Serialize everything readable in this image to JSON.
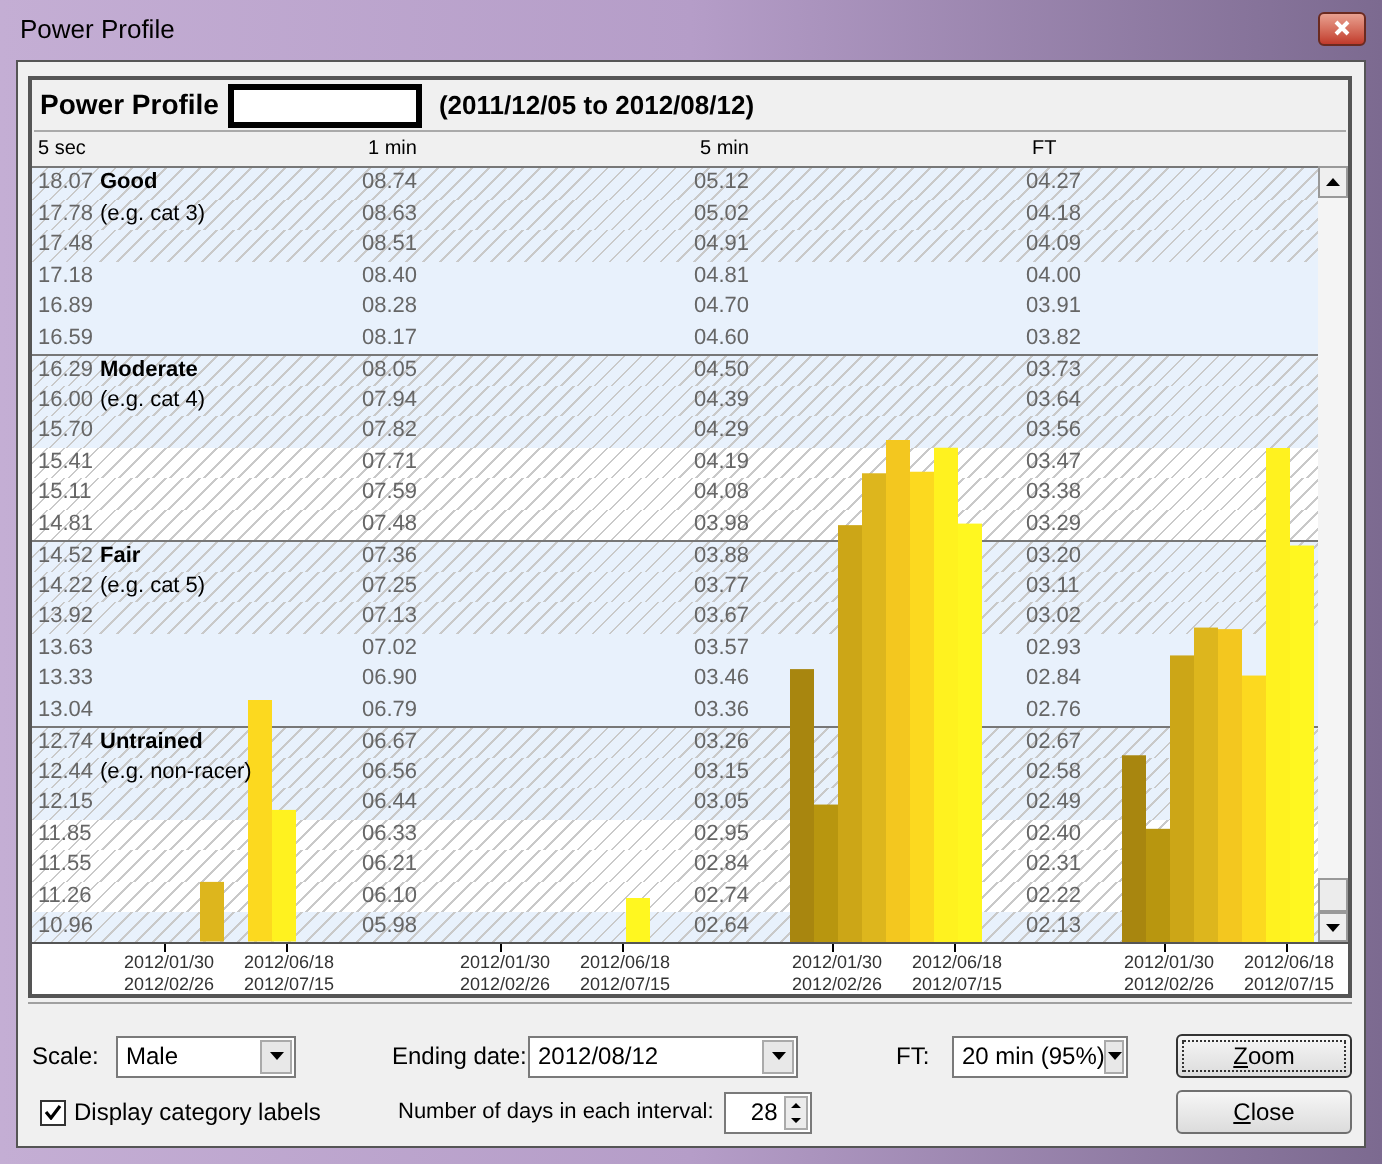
{
  "window": {
    "title": "Power Profile"
  },
  "header": {
    "title": "Power Profile",
    "date_range": "(2011/12/05 to 2012/08/12)"
  },
  "columns": [
    {
      "label": "5 sec",
      "axis_labels": [
        "2012/01/30",
        "2012/02/26",
        "2012/06/18",
        "2012/07/15"
      ]
    },
    {
      "label": "1 min",
      "axis_labels": [
        "2012/01/30",
        "2012/02/26",
        "2012/06/18",
        "2012/07/15"
      ]
    },
    {
      "label": "5 min",
      "axis_labels": [
        "2012/01/30",
        "2012/02/26",
        "2012/06/18",
        "2012/07/15"
      ]
    },
    {
      "label": "FT",
      "axis_labels": [
        "2012/01/30",
        "2012/02/26",
        "2012/06/18",
        "2012/07/15"
      ]
    }
  ],
  "categories": [
    {
      "name": "Good",
      "example": "(e.g. cat 3)",
      "rows": [
        {
          "kind": "hatched_blue",
          "values": [
            "18.07",
            "08.74",
            "05.12",
            "04.27"
          ]
        },
        {
          "kind": "hatched_blue",
          "values": [
            "17.78",
            "08.63",
            "05.02",
            "04.18"
          ]
        },
        {
          "kind": "hatched_blue",
          "values": [
            "17.48",
            "08.51",
            "04.91",
            "04.09"
          ]
        },
        {
          "kind": "blue",
          "values": [
            "17.18",
            "08.40",
            "04.81",
            "04.00"
          ]
        },
        {
          "kind": "blue",
          "values": [
            "16.89",
            "08.28",
            "04.70",
            "03.91"
          ]
        },
        {
          "kind": "blue",
          "values": [
            "16.59",
            "08.17",
            "04.60",
            "03.82"
          ]
        }
      ]
    },
    {
      "name": "Moderate",
      "example": "(e.g. cat 4)",
      "rows": [
        {
          "kind": "hatched_blue",
          "values": [
            "16.29",
            "08.05",
            "04.50",
            "03.73"
          ]
        },
        {
          "kind": "hatched_blue",
          "values": [
            "16.00",
            "07.94",
            "04.39",
            "03.64"
          ]
        },
        {
          "kind": "hatched_blue",
          "values": [
            "15.70",
            "07.82",
            "04.29",
            "03.56"
          ]
        },
        {
          "kind": "hatched_white",
          "values": [
            "15.41",
            "07.71",
            "04.19",
            "03.47"
          ]
        },
        {
          "kind": "hatched_white",
          "values": [
            "15.11",
            "07.59",
            "04.08",
            "03.38"
          ]
        },
        {
          "kind": "hatched_white",
          "values": [
            "14.81",
            "07.48",
            "03.98",
            "03.29"
          ]
        }
      ]
    },
    {
      "name": "Fair",
      "example": "(e.g. cat 5)",
      "rows": [
        {
          "kind": "hatched_blue",
          "values": [
            "14.52",
            "07.36",
            "03.88",
            "03.20"
          ]
        },
        {
          "kind": "hatched_blue",
          "values": [
            "14.22",
            "07.25",
            "03.77",
            "03.11"
          ]
        },
        {
          "kind": "hatched_blue",
          "values": [
            "13.92",
            "07.13",
            "03.67",
            "03.02"
          ]
        },
        {
          "kind": "blue",
          "values": [
            "13.63",
            "07.02",
            "03.57",
            "02.93"
          ]
        },
        {
          "kind": "blue",
          "values": [
            "13.33",
            "06.90",
            "03.46",
            "02.84"
          ]
        },
        {
          "kind": "blue",
          "values": [
            "13.04",
            "06.79",
            "03.36",
            "02.76"
          ]
        }
      ]
    },
    {
      "name": "Untrained",
      "example": "(e.g. non-racer)",
      "rows": [
        {
          "kind": "hatched_blue",
          "values": [
            "12.74",
            "06.67",
            "03.26",
            "02.67"
          ]
        },
        {
          "kind": "hatched_blue",
          "values": [
            "12.44",
            "06.56",
            "03.15",
            "02.58"
          ]
        },
        {
          "kind": "hatched_blue",
          "values": [
            "12.15",
            "06.44",
            "03.05",
            "02.49"
          ]
        },
        {
          "kind": "hatched_white",
          "values": [
            "11.85",
            "06.33",
            "02.95",
            "02.40"
          ]
        },
        {
          "kind": "hatched_white",
          "values": [
            "11.55",
            "06.21",
            "02.84",
            "02.31"
          ]
        },
        {
          "kind": "hatched_white",
          "values": [
            "11.26",
            "06.10",
            "02.74",
            "02.22"
          ]
        },
        {
          "kind": "hatched_blue",
          "values": [
            "10.96",
            "05.98",
            "02.64",
            "02.13"
          ]
        }
      ]
    }
  ],
  "controls": {
    "scale": {
      "label": "Scale:",
      "value": "Male"
    },
    "ending_date": {
      "label": "Ending date:",
      "value": "2012/08/12"
    },
    "ft": {
      "label": "FT:",
      "value": "20 min (95%)"
    },
    "display_labels": {
      "label": "Display category labels",
      "checked": true
    },
    "days": {
      "label": "Number of days in each interval:",
      "value": "28"
    }
  },
  "buttons": [
    {
      "label": "Zoom",
      "focused": true
    },
    {
      "label": "Close",
      "focused": false
    }
  ]
}
